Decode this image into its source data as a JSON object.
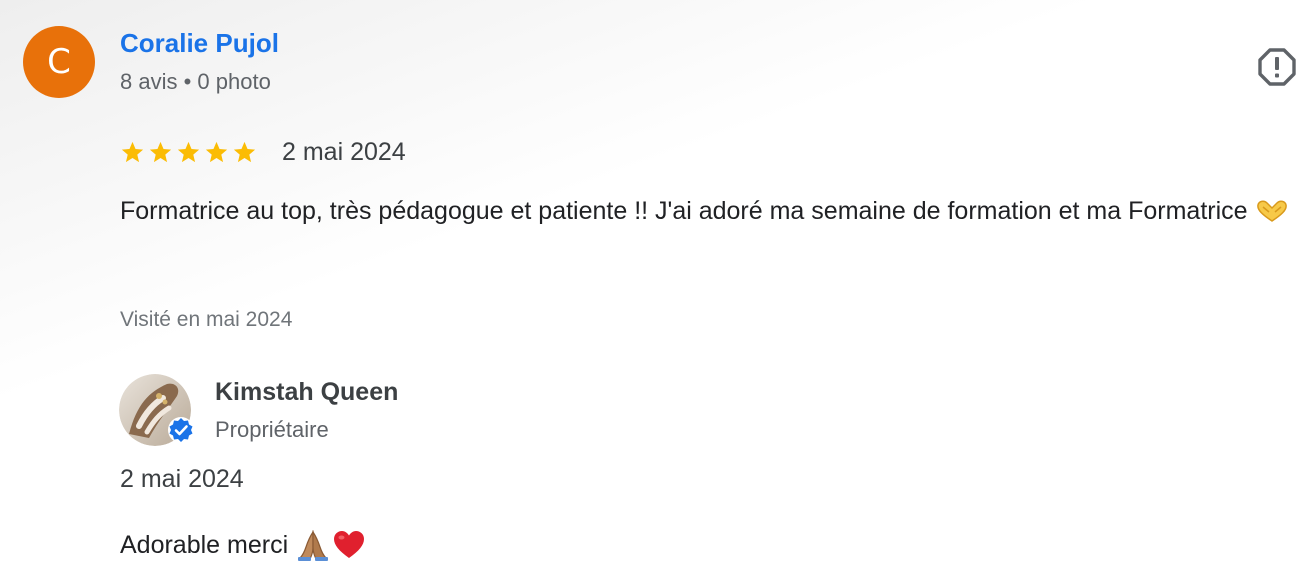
{
  "review": {
    "reviewer": {
      "initial": "C",
      "name": "Coralie Pujol",
      "meta": "8 avis • 0 photo",
      "avatar_color": "#e8710a"
    },
    "rating": {
      "stars": 5,
      "max": 5,
      "star_color": "#fbbc04"
    },
    "date": "2 mai 2024",
    "text": "Formatrice au top, très pédagogue et patiente !! J'ai adoré ma semaine de formation et ma Formatrice",
    "text_emoji": "heart-hands-icon",
    "visit": "Visité en mai 2024",
    "flag_icon": "report-flag-icon"
  },
  "owner_reply": {
    "name": "Kimstah Queen",
    "role": "Propriétaire",
    "verified_icon": "verified-check-icon",
    "verified_color": "#1a73e8",
    "date": "2 mai 2024",
    "text": "Adorable merci",
    "emojis": [
      "folded-hands-icon",
      "red-heart-icon"
    ]
  }
}
